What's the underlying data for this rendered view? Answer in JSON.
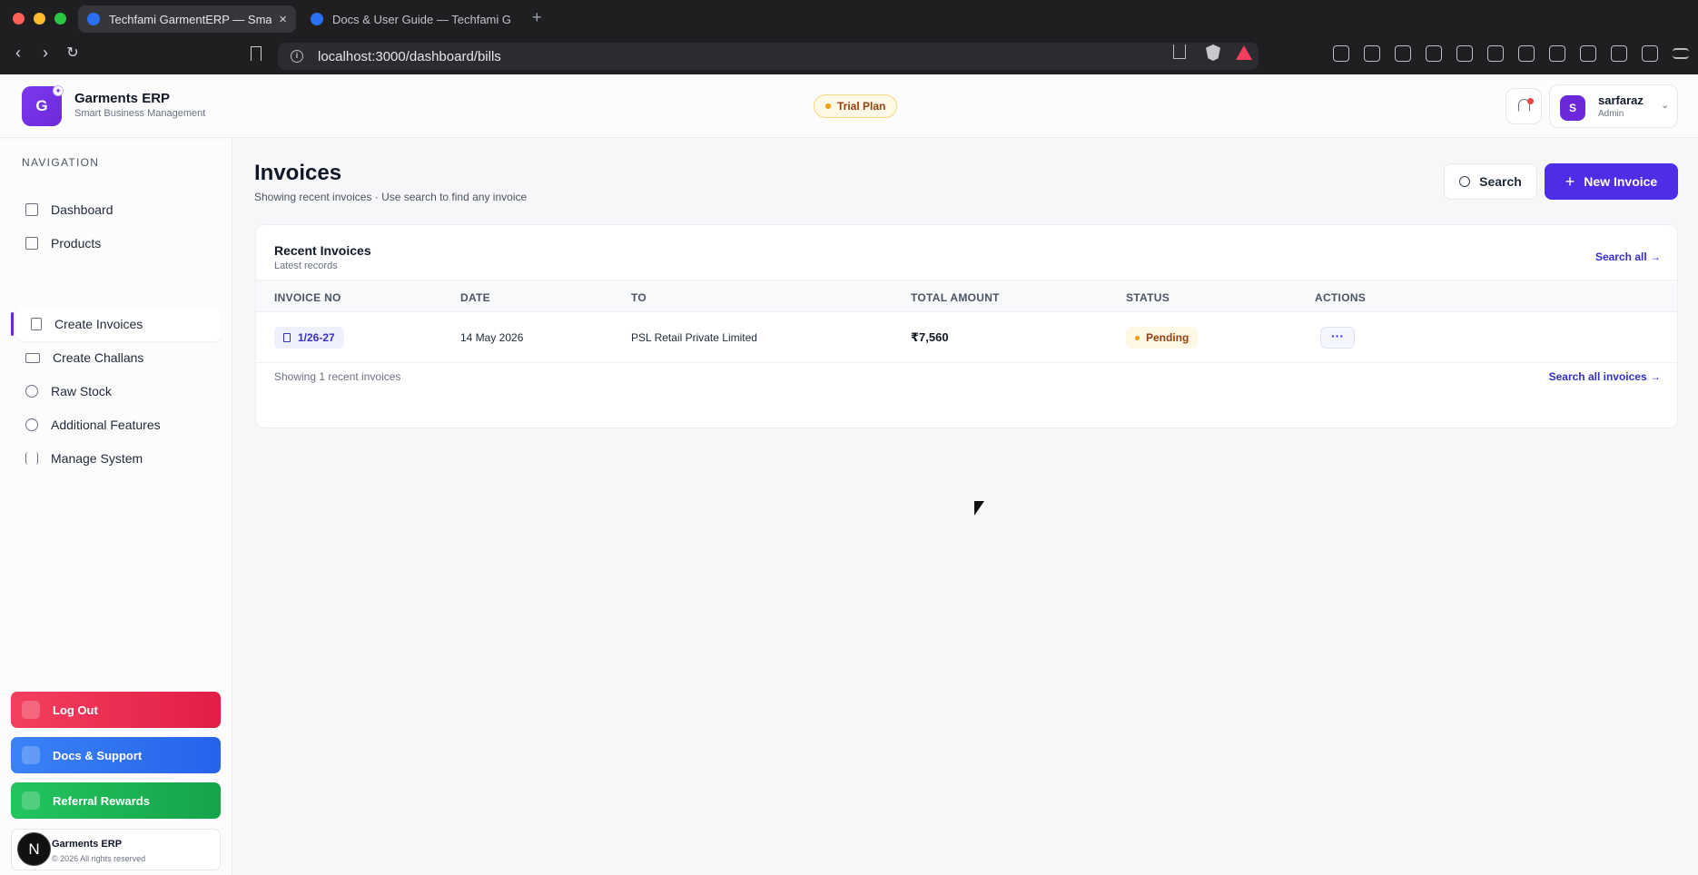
{
  "browser": {
    "tabs": [
      {
        "title": "Techfami GarmentERP — Smart",
        "active": true
      },
      {
        "title": "Docs & User Guide — Techfami Ga",
        "active": false
      }
    ],
    "url": "localhost:3000/dashboard/bills"
  },
  "header": {
    "logo_letter": "G",
    "brand_name": "Garments ERP",
    "brand_sub": "Smart Business Management",
    "plan_badge": "Trial Plan",
    "user": {
      "initial": "S",
      "name": "sarfaraz",
      "role": "Admin"
    }
  },
  "sidebar": {
    "heading": "NAVIGATION",
    "items": [
      {
        "label": "Dashboard",
        "icon": "grid-icon"
      },
      {
        "label": "Products",
        "icon": "box-icon"
      },
      {
        "label": "Create Invoices",
        "icon": "document-icon",
        "active": true
      },
      {
        "label": "Create Challans",
        "icon": "truck-icon"
      },
      {
        "label": "Raw Stock",
        "icon": "layers-icon"
      },
      {
        "label": "Additional Features",
        "icon": "circle-arrow-icon"
      },
      {
        "label": "Manage System",
        "icon": "sliders-icon"
      }
    ],
    "logout_label": "Log Out",
    "docs_label": "Docs & Support",
    "referral_label": "Referral Rewards",
    "footer_title": "Garments ERP",
    "footer_sub": "© 2026 All rights reserved",
    "next_badge": "N"
  },
  "main": {
    "title": "Invoices",
    "subtitle": "Showing recent invoices · Use search to find any invoice",
    "search_label": "Search",
    "new_label": "New Invoice",
    "card": {
      "title": "Recent Invoices",
      "subtitle": "Latest records",
      "search_all": "Search all →",
      "columns": [
        "INVOICE NO",
        "DATE",
        "TO",
        "TOTAL AMOUNT",
        "STATUS",
        "ACTIONS"
      ],
      "rows": [
        {
          "invoice_no": "1/26-27",
          "date": "14 May 2026",
          "to": "PSL Retail Private Limited",
          "amount": "₹7,560",
          "status": "Pending",
          "actions": "···"
        }
      ],
      "footer": "Showing 1 recent invoices",
      "search_all_invoices": "Search all invoices →"
    }
  },
  "colors": {
    "accent": "#4f2ce6",
    "logout": "#e11d48",
    "docs": "#2563eb",
    "referral": "#16a34a",
    "pending": "#f59e0b"
  }
}
